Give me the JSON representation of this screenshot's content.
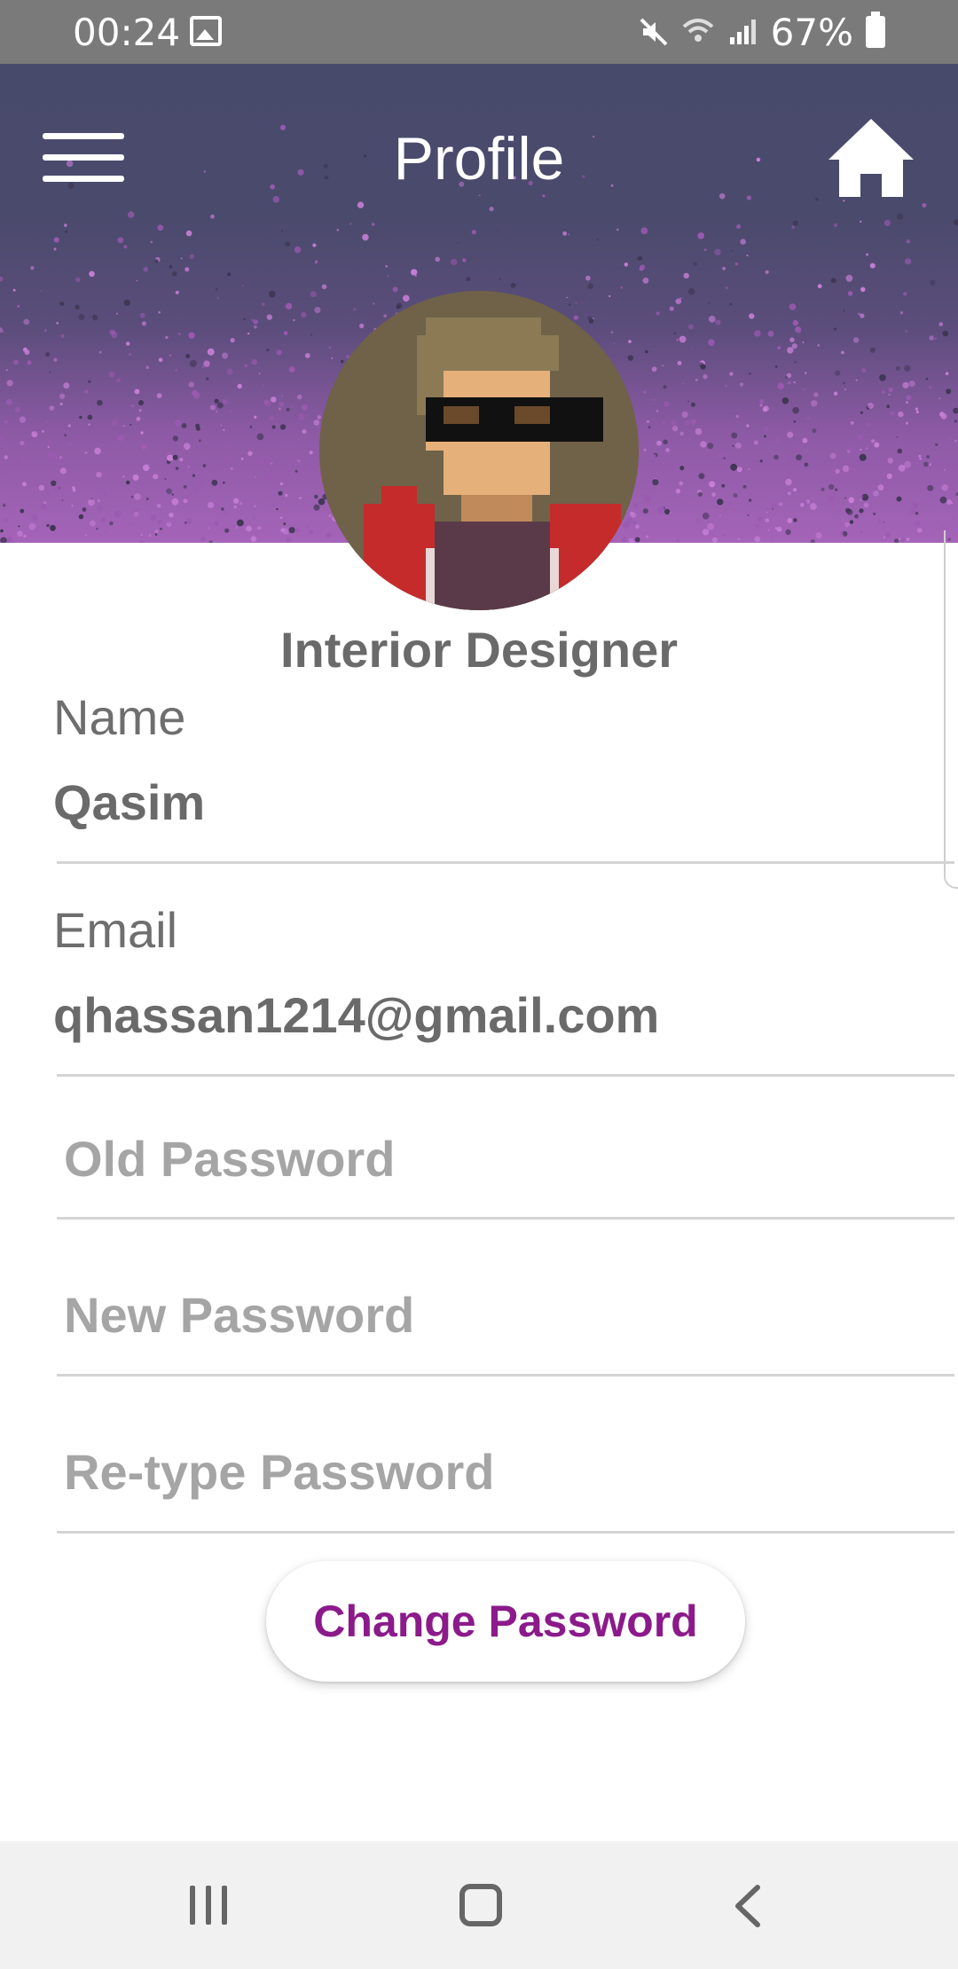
{
  "status_bar": {
    "time": "00:24",
    "battery_percent": "67%",
    "icons": [
      "image-icon",
      "mute-icon",
      "wifi-icon",
      "signal-icon",
      "battery-icon"
    ]
  },
  "header": {
    "title": "Profile",
    "menu_icon": "hamburger-menu-icon",
    "home_icon": "home-icon"
  },
  "profile": {
    "role": "Interior Designer",
    "name_label": "Name",
    "name_value": "Qasim",
    "email_label": "Email",
    "email_value": "qhassan1214@gmail.com"
  },
  "password_form": {
    "old_placeholder": "Old Password",
    "new_placeholder": "New Password",
    "retype_placeholder": "Re-type Password",
    "submit_label": "Change Password"
  },
  "nav_bar": {
    "icons": [
      "recent-apps-icon",
      "home-circle-icon",
      "back-icon"
    ]
  },
  "colors": {
    "header_top": "#484a6c",
    "header_bottom": "#a464b8",
    "accent": "#8b1a8b",
    "status_bar": "#7a7a7a",
    "nav_bar": "#f1f1f1"
  }
}
